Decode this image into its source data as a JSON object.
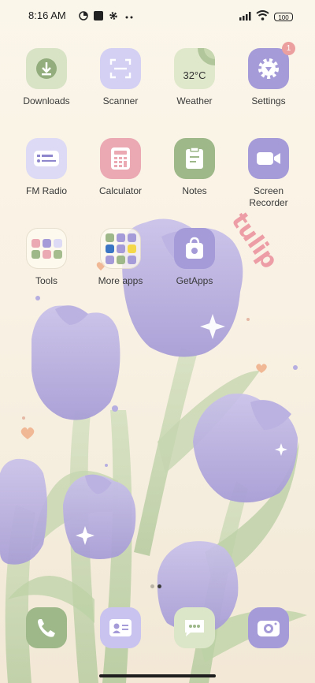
{
  "status": {
    "time": "8:16 AM",
    "battery": "100"
  },
  "apps": [
    {
      "label": "Downloads",
      "icon": "download-icon"
    },
    {
      "label": "Scanner",
      "icon": "scanner-icon"
    },
    {
      "label": "Weather",
      "icon": "weather-icon",
      "temp": "32°C"
    },
    {
      "label": "Settings",
      "icon": "gear-icon",
      "badge": "1"
    },
    {
      "label": "FM Radio",
      "icon": "radio-icon"
    },
    {
      "label": "Calculator",
      "icon": "calculator-icon"
    },
    {
      "label": "Notes",
      "icon": "notes-icon"
    },
    {
      "label": "Screen\nRecorder",
      "icon": "video-camera-icon"
    },
    {
      "label": "Tools",
      "icon": "folder-icon"
    },
    {
      "label": "More apps",
      "icon": "folder-icon"
    },
    {
      "label": "GetApps",
      "icon": "shopping-bag-icon"
    }
  ],
  "wallpaper": {
    "text": "tulip"
  },
  "dock": [
    "phone-icon",
    "contacts-icon",
    "messages-icon",
    "camera-icon"
  ],
  "colors": {
    "lavender": "#a99dd8",
    "sage": "#a5bd8e",
    "pink": "#e9a7b0"
  }
}
